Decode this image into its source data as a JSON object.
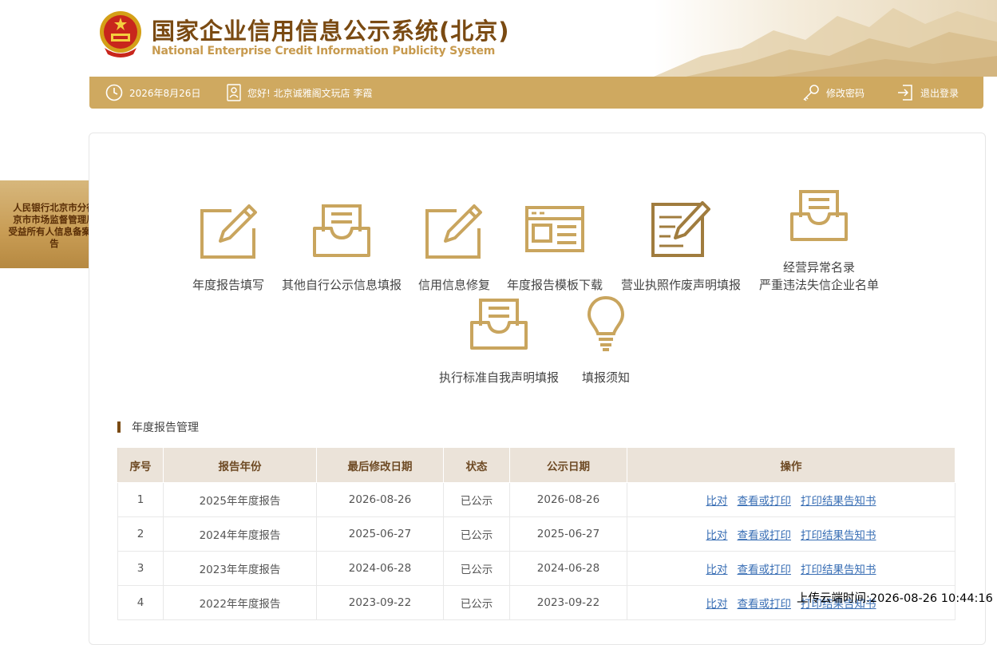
{
  "header": {
    "title": "国家企业信用信息公示系统(北京)",
    "subtitle": "National Enterprise Credit Information Publicity System"
  },
  "topbar": {
    "date": "2026年8月26日",
    "greeting": "您好! 北京诚雅阁文玩店 李霞",
    "change_password": "修改密码",
    "logout": "退出登录"
  },
  "side_banner": {
    "lines": [
      "人民银行北京市分行",
      "京市市场监督管理局",
      "受益所有人信息备案公",
      "告"
    ]
  },
  "tiles": [
    {
      "label": "年度报告填写",
      "icon": "edit-form-icon"
    },
    {
      "label": "其他自行公示信息填报",
      "icon": "inbox-tray-icon"
    },
    {
      "label": "信用信息修复",
      "icon": "edit-form-icon"
    },
    {
      "label": "年度报告模板下载",
      "icon": "template-window-icon"
    },
    {
      "label": "营业执照作废声明填报",
      "icon": "edit-document-icon"
    },
    {
      "label": "经营异常名录",
      "label2": "严重违法失信企业名单",
      "icon": "inbox-tray-icon"
    },
    {
      "label": "执行标准自我声明填报",
      "icon": "inbox-tray-icon"
    },
    {
      "label": "填报须知",
      "icon": "lightbulb-icon"
    }
  ],
  "section": {
    "title": "年度报告管理"
  },
  "table": {
    "headers": [
      "序号",
      "报告年份",
      "最后修改日期",
      "状态",
      "公示日期",
      "操作"
    ],
    "actions": [
      "比对",
      "查看或打印",
      "打印结果告知书"
    ],
    "rows": [
      [
        "1",
        "2025年年度报告",
        "2026-08-26",
        "已公示",
        "2026-08-26"
      ],
      [
        "2",
        "2024年年度报告",
        "2025-06-27",
        "已公示",
        "2025-06-27"
      ],
      [
        "3",
        "2023年年度报告",
        "2024-06-28",
        "已公示",
        "2024-06-28"
      ],
      [
        "4",
        "2022年年度报告",
        "2023-09-22",
        "已公示",
        "2023-09-22"
      ]
    ]
  },
  "upload_stamp": "上传云端时间:2026-08-26 10:44:16",
  "colors": {
    "gold": "#cfa960",
    "brown": "#7a4a12",
    "icon_gold": "#c9a55e",
    "link": "#3a6fb5"
  }
}
